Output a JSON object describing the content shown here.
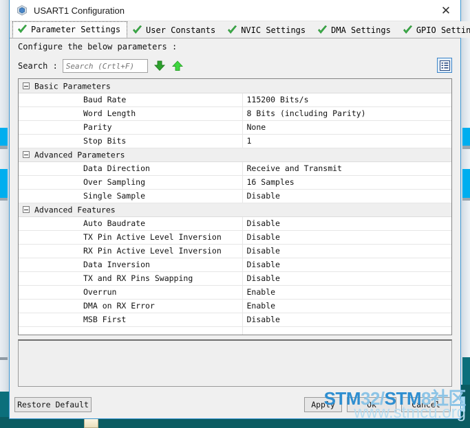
{
  "window": {
    "title": "USART1 Configuration",
    "app_icon": "cube-icon",
    "close_label": "✕"
  },
  "tabs": [
    {
      "label": "Parameter Settings",
      "icon": "green-check-icon",
      "active": true
    },
    {
      "label": "User Constants",
      "icon": "green-check-icon",
      "active": false
    },
    {
      "label": "NVIC Settings",
      "icon": "green-check-icon",
      "active": false
    },
    {
      "label": "DMA Settings",
      "icon": "green-check-icon",
      "active": false
    },
    {
      "label": "GPIO Settings",
      "icon": "green-check-icon",
      "active": false
    }
  ],
  "instruction": "Configure the below parameters :",
  "search": {
    "label": "Search :",
    "value": "",
    "placeholder": "Search (Crtl+F)",
    "find_next_icon": "arrow-down-icon",
    "find_prev_icon": "arrow-up-icon",
    "list_view_icon": "list-view-icon"
  },
  "parameters": [
    {
      "type": "group",
      "name": "Basic Parameters",
      "expanded": true
    },
    {
      "type": "row",
      "name": "Baud Rate",
      "value": "115200 Bits/s"
    },
    {
      "type": "row",
      "name": "Word Length",
      "value": "8 Bits (including Parity)"
    },
    {
      "type": "row",
      "name": "Parity",
      "value": "None"
    },
    {
      "type": "row",
      "name": "Stop Bits",
      "value": "1"
    },
    {
      "type": "group",
      "name": "Advanced Parameters",
      "expanded": true
    },
    {
      "type": "row",
      "name": "Data Direction",
      "value": "Receive and Transmit"
    },
    {
      "type": "row",
      "name": "Over Sampling",
      "value": "16 Samples"
    },
    {
      "type": "row",
      "name": "Single Sample",
      "value": "Disable"
    },
    {
      "type": "group",
      "name": "Advanced Features",
      "expanded": true
    },
    {
      "type": "row",
      "name": "Auto Baudrate",
      "value": "Disable"
    },
    {
      "type": "row",
      "name": "TX Pin Active Level Inversion",
      "value": "Disable"
    },
    {
      "type": "row",
      "name": "RX Pin Active Level Inversion",
      "value": "Disable"
    },
    {
      "type": "row",
      "name": "Data Inversion",
      "value": "Disable"
    },
    {
      "type": "row",
      "name": "TX and RX Pins Swapping",
      "value": "Disable"
    },
    {
      "type": "row",
      "name": "Overrun",
      "value": "Enable"
    },
    {
      "type": "row",
      "name": "DMA on RX Error",
      "value": "Enable"
    },
    {
      "type": "row",
      "name": "MSB First",
      "value": "Disable"
    }
  ],
  "description_panel": {
    "text": ""
  },
  "buttons": {
    "restore_default": "Restore Default",
    "apply": "Apply",
    "ok": "Ok",
    "cancel": "Cancel"
  },
  "watermark": {
    "line1_solid_a": "STM",
    "line1_faded_a": "32/",
    "line1_solid_b": "STM",
    "line1_faded_b": "8社区",
    "line2": "www.stmcu.org"
  },
  "colors": {
    "accent_blue": "#3b97d3",
    "check_green": "#35b235",
    "arrow_green": "#2fbf2f",
    "desktop_teal": "#0b5c62",
    "watermark_blue": "#2e8ed0"
  }
}
